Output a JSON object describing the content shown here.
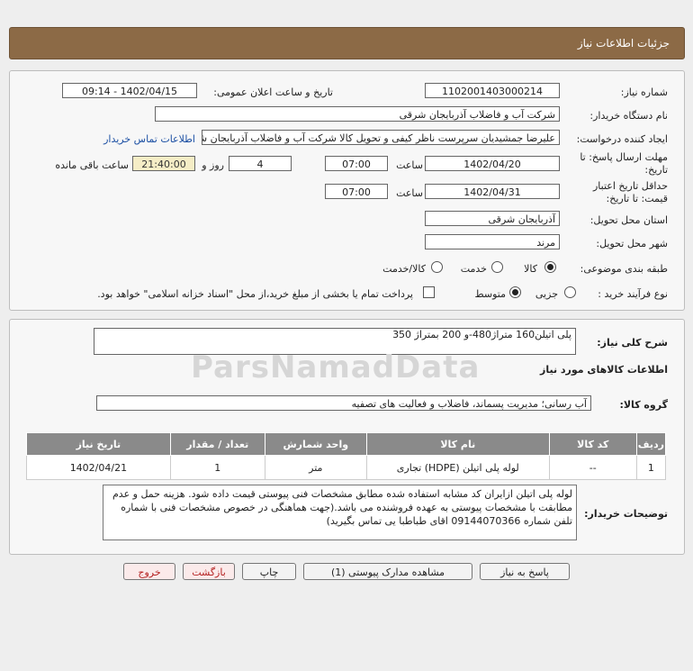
{
  "header": {
    "title": "جزئیات اطلاعات نیاز"
  },
  "form": {
    "need_number_label": "شماره نیاز:",
    "need_number": "1102001403000214",
    "announce_label": "تاریخ و ساعت اعلان عمومی:",
    "announce_value": "1402/04/15 - 09:14",
    "buyer_org_label": "نام دستگاه خریدار:",
    "buyer_org": "شرکت آب و فاضلاب آذربایجان شرقی",
    "creator_label": "ایجاد کننده درخواست:",
    "creator": "علیرضا جمشیدیان سرپرست ناظر کیفی و تحویل کالا شرکت آب و فاضلاب آذربایجان شرقی",
    "contact_link": "اطلاعات تماس خریدار",
    "deadline_label_1": "مهلت ارسال پاسخ: تا",
    "deadline_label_2": "تاریخ:",
    "deadline_date": "1402/04/20",
    "time_label": "ساعت",
    "deadline_time": "07:00",
    "days_value": "4",
    "days_label": "روز و",
    "remaining_time": "21:40:00",
    "remaining_label": "ساعت باقی مانده",
    "validity_label_1": "حداقل تاریخ اعتبار",
    "validity_label_2": "قیمت: تا تاریخ:",
    "validity_date": "1402/04/31",
    "validity_time": "07:00",
    "province_label": "استان محل تحویل:",
    "province": "آذربایجان شرقی",
    "city_label": "شهر محل تحویل:",
    "city": "مرند",
    "category_label": "طبقه بندی موضوعی:",
    "category_options": [
      "کالا",
      "خدمت",
      "کالا/خدمت"
    ],
    "process_label": "نوع فرآیند خرید :",
    "process_options": [
      "جزیی",
      "متوسط"
    ],
    "payment_note": "پرداخت تمام یا بخشی از مبلغ خرید،از محل \"اسناد خزانه اسلامی\" خواهد بود."
  },
  "summary": {
    "label": "شرح کلی نیاز:",
    "value": "پلی اتیلن160 متراژ480-و 200  بمتراژ 350",
    "goods_info_title": "اطلاعات کالاهای مورد نیاز",
    "group_label": "گروه کالا:",
    "group_value": "آب رسانی؛ مدیریت پسماند، فاضلاب و فعالیت های تصفیه"
  },
  "table": {
    "headers": [
      "ردیف",
      "کد کالا",
      "نام کالا",
      "واحد شمارش",
      "تعداد / مقدار",
      "تاریخ نیاز"
    ],
    "rows": [
      [
        "1",
        "--",
        "لوله پلی اتیلن (HDPE) تجاری",
        "متر",
        "1",
        "1402/04/21"
      ]
    ]
  },
  "notes": {
    "label": "توضیحات خریدار:",
    "text": "لوله پلی اتیلن ازایران کد مشابه استفاده شده مطابق مشخصات فنی پیوستی قیمت داده شود. هزینه حمل و عدم مطابقت با مشخصات پیوستی به عهده فروشنده می باشد.(جهت هماهنگی در خصوص مشخصات فنی با شماره تلفن شماره 09144070366 اقای طباطبا یی تماس بگیرید)"
  },
  "buttons": {
    "reply": "پاسخ به نیاز",
    "attachments": "مشاهده مدارک پیوستی (1)",
    "print": "چاپ",
    "back": "بازگشت",
    "exit": "خروج"
  },
  "watermark": {
    "text": "ParsNamadData"
  }
}
